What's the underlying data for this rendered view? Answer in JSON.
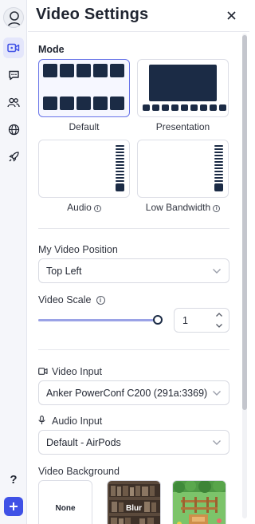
{
  "rail": {
    "items": [
      {
        "name": "video-settings",
        "icon": "video-camera-icon",
        "active": true
      },
      {
        "name": "chat",
        "icon": "chat-bubble-icon",
        "active": false
      },
      {
        "name": "people",
        "icon": "people-icon",
        "active": false
      },
      {
        "name": "globe",
        "icon": "globe-icon",
        "active": false
      },
      {
        "name": "launch",
        "icon": "rocket-icon",
        "active": false
      }
    ],
    "help_label": "?",
    "accent": "#3f51e6"
  },
  "header": {
    "title": "Video Settings"
  },
  "mode": {
    "label": "Mode",
    "options": [
      {
        "label": "Default",
        "selected": true
      },
      {
        "label": "Presentation",
        "selected": false
      },
      {
        "label": "Audio",
        "selected": false
      },
      {
        "label": "Low Bandwidth",
        "selected": false
      }
    ]
  },
  "video_position": {
    "label": "My Video Position",
    "value": "Top Left"
  },
  "video_scale": {
    "label": "Video Scale",
    "value": "1",
    "slider_fraction": 1.0
  },
  "video_input": {
    "label": "Video Input",
    "value": "Anker PowerConf C200 (291a:3369)"
  },
  "audio_input": {
    "label": "Audio Input",
    "value": "Default - AirPods"
  },
  "video_background": {
    "label": "Video Background",
    "options": [
      {
        "label": "None"
      },
      {
        "label": "Blur"
      },
      {
        "label": ""
      }
    ]
  },
  "colors": {
    "tile_dark": "#1b2b45",
    "selected_border": "#6874e8"
  }
}
